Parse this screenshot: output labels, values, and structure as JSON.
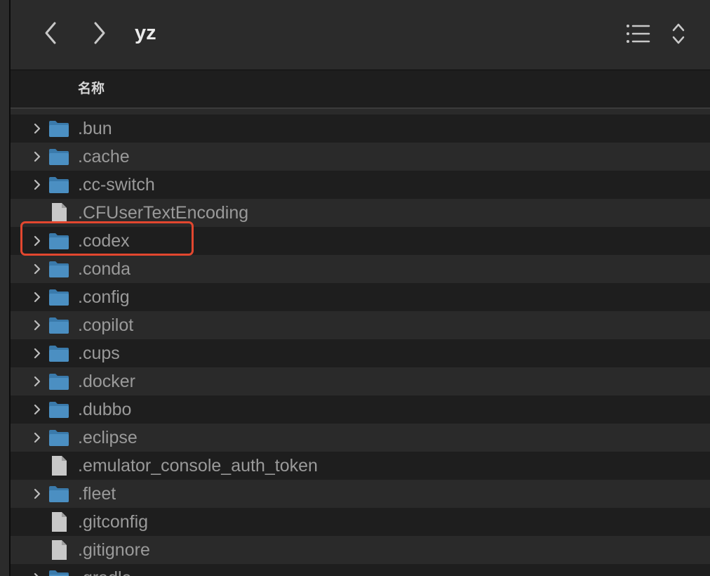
{
  "window": {
    "title": "yz"
  },
  "toolbar": {
    "back_icon": "chevron-left-icon",
    "forward_icon": "chevron-right-icon",
    "view_icon": "list-view-icon",
    "view_arrows_icon": "up-down-chevron-icon"
  },
  "columns": {
    "name": "名称"
  },
  "files": [
    {
      "name": ".bun",
      "type": "folder",
      "expandable": true
    },
    {
      "name": ".cache",
      "type": "folder",
      "expandable": true
    },
    {
      "name": ".cc-switch",
      "type": "folder",
      "expandable": true
    },
    {
      "name": ".CFUserTextEncoding",
      "type": "file",
      "expandable": false
    },
    {
      "name": ".codex",
      "type": "folder",
      "expandable": true,
      "highlighted": true
    },
    {
      "name": ".conda",
      "type": "folder",
      "expandable": true
    },
    {
      "name": ".config",
      "type": "folder",
      "expandable": true
    },
    {
      "name": ".copilot",
      "type": "folder",
      "expandable": true
    },
    {
      "name": ".cups",
      "type": "folder",
      "expandable": true
    },
    {
      "name": ".docker",
      "type": "folder",
      "expandable": true
    },
    {
      "name": ".dubbo",
      "type": "folder",
      "expandable": true
    },
    {
      "name": ".eclipse",
      "type": "folder",
      "expandable": true
    },
    {
      "name": ".emulator_console_auth_token",
      "type": "file",
      "expandable": false
    },
    {
      "name": ".fleet",
      "type": "folder",
      "expandable": true
    },
    {
      "name": ".gitconfig",
      "type": "file",
      "expandable": false
    },
    {
      "name": ".gitignore",
      "type": "file",
      "expandable": false
    },
    {
      "name": ".gradle",
      "type": "folder",
      "expandable": true
    }
  ],
  "colors": {
    "folder_front": "#4b8fc2",
    "folder_back": "#3a7aab",
    "file_body": "#c8c8c8",
    "highlight_border": "#e2472f",
    "text_secondary": "#9a9a9a"
  }
}
